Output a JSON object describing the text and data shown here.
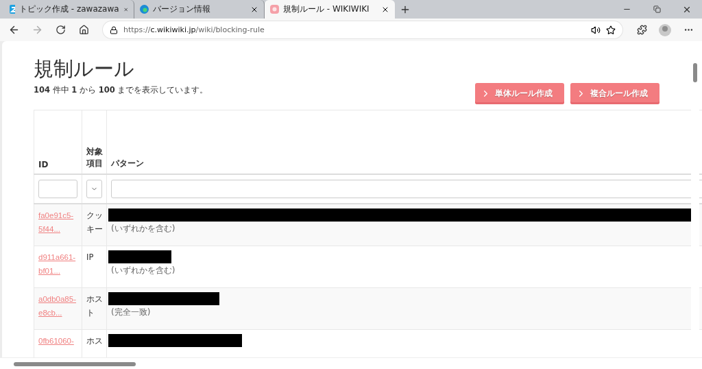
{
  "browser": {
    "tabs": [
      {
        "title": "トピック作成 - zawazawa",
        "selected": false
      },
      {
        "title": "バージョン情報",
        "selected": false
      },
      {
        "title": "規制ルール - WIKIWIKI",
        "selected": true
      }
    ],
    "address": {
      "scheme": "https://",
      "host": "c.wikiwiki.jp",
      "path": "/wiki/blocking-rule"
    }
  },
  "page": {
    "title": "規制ルール",
    "summary": "**104** 件中 **1** から **100** までを表示しています。",
    "buttons": [
      "単体ルール作成",
      "複合ルール作成"
    ]
  },
  "table": {
    "columns": [
      "ID",
      "対象項目",
      "パターン"
    ],
    "rows": [
      {
        "id": "fa0e91c5-5f44...",
        "target": "クッキー",
        "match": "(いずれかを含む)"
      },
      {
        "id": "d911a661-bf01...",
        "target": "IP",
        "match": "(いずれかを含む)"
      },
      {
        "id": "a0db0a85-e8cb...",
        "target": "ホスト",
        "match": "(完全一致)"
      },
      {
        "id": "0fb61060-",
        "target": "ホス"
      }
    ]
  }
}
